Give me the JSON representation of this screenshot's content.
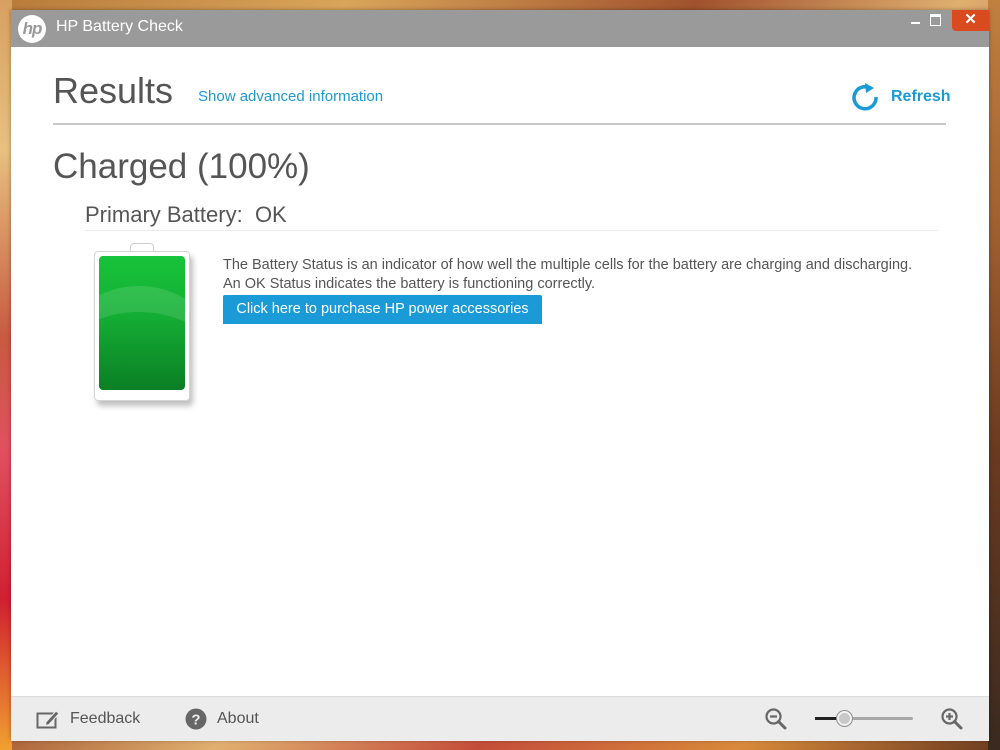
{
  "window": {
    "title": "HP Battery Check",
    "logo_text": "hp",
    "controls": {
      "minimize": "minimize",
      "maximize": "maximize",
      "close_glyph": "✕"
    }
  },
  "header": {
    "title": "Results",
    "advanced_link": "Show advanced information",
    "refresh_label": "Refresh",
    "refresh_icon": "refresh-icon"
  },
  "status": {
    "headline": "Charged (100%)",
    "charge_percent": 100,
    "battery_label": "Primary Battery:",
    "battery_status": "OK",
    "battery_icon": "battery-full-icon",
    "battery_color": "#17c43a",
    "description_lines": [
      "The Battery Status is an indicator of how well the multiple cells for the battery are charging and discharging.",
      "An OK Status indicates the battery is functioning correctly."
    ],
    "purchase_button": "Click here to purchase HP power accessories"
  },
  "footer": {
    "feedback_label": "Feedback",
    "feedback_icon": "feedback-pencil-icon",
    "about_label": "About",
    "about_icon": "question-circle-icon",
    "zoom_out_icon": "zoom-out-icon",
    "zoom_in_icon": "zoom-in-icon",
    "zoom_level_fraction": 0.3
  },
  "colors": {
    "accent": "#1a9ad6",
    "titlebar": "#9a9a9a",
    "close": "#d94a1e",
    "text": "#555555",
    "footer": "#ececec"
  }
}
